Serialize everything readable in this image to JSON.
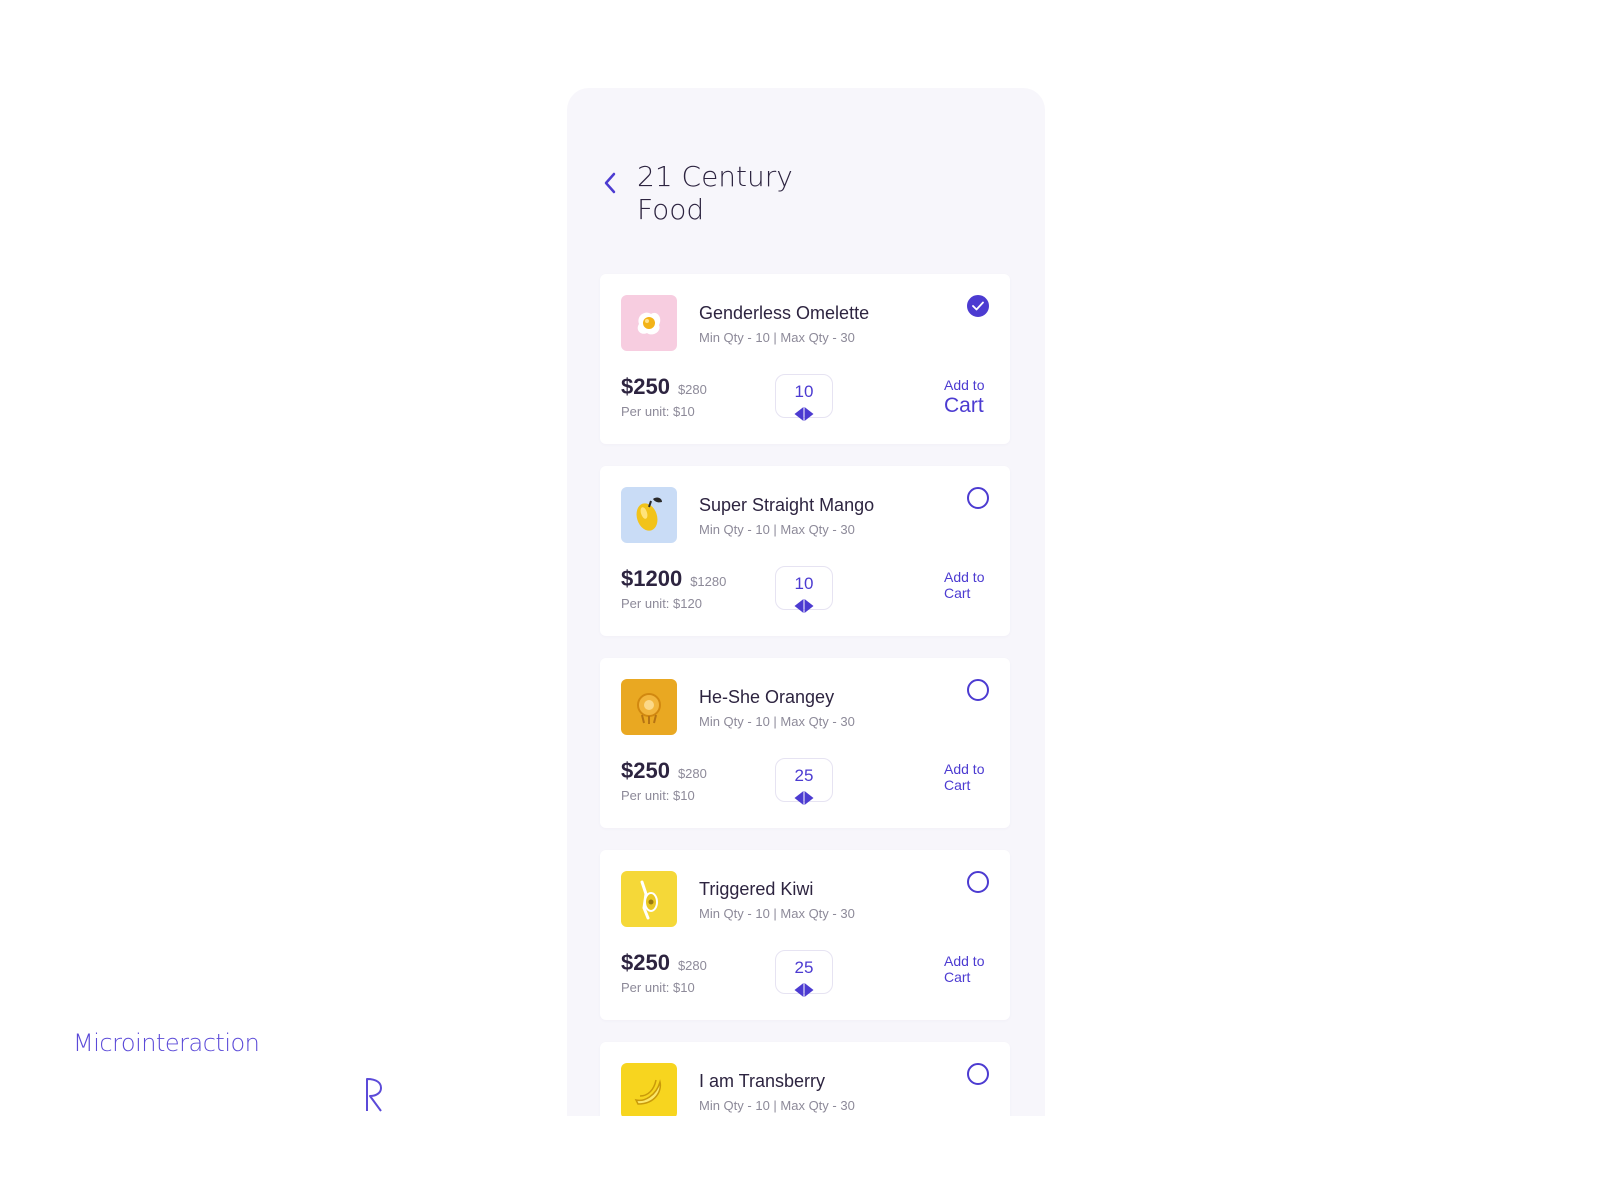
{
  "header": {
    "title": "21 Century Food"
  },
  "products": [
    {
      "name": "Genderless Omelette",
      "qty_range": "Min Qty - 10 | Max Qty - 30",
      "price": "$250",
      "old_price": "$280",
      "per_unit": "Per unit: $10",
      "quantity": "10",
      "selected": true,
      "add_line1": "Add to",
      "add_line2": "Cart",
      "thumb_color": "#f7cde0",
      "icon": "egg-icon"
    },
    {
      "name": "Super Straight Mango",
      "qty_range": "Min Qty - 10 | Max Qty - 30",
      "price": "$1200",
      "old_price": "$1280",
      "per_unit": "Per unit: $120",
      "quantity": "10",
      "selected": false,
      "add_line1": "Add to",
      "add_line2": "Cart",
      "thumb_color": "#c9dcf6",
      "icon": "mango-icon"
    },
    {
      "name": "He-She Orangey",
      "qty_range": "Min Qty - 10 | Max Qty - 30",
      "price": "$250",
      "old_price": "$280",
      "per_unit": "Per unit: $10",
      "quantity": "25",
      "selected": false,
      "add_line1": "Add to",
      "add_line2": "Cart",
      "thumb_color": "#e9a822",
      "icon": "orange-icon"
    },
    {
      "name": "Triggered Kiwi",
      "qty_range": "Min Qty - 10 | Max Qty - 30",
      "price": "$250",
      "old_price": "$280",
      "per_unit": "Per unit: $10",
      "quantity": "25",
      "selected": false,
      "add_line1": "Add to",
      "add_line2": "Cart",
      "thumb_color": "#f5d838",
      "icon": "kiwi-icon"
    },
    {
      "name": "I am Transberry",
      "qty_range": "Min Qty - 10 | Max Qty - 30",
      "selected": false,
      "thumb_color": "#f7d51f",
      "icon": "banana-icon"
    }
  ],
  "footer": {
    "label": "Microinteraction"
  },
  "colors": {
    "accent": "#4c3bd1",
    "text": "#2d2440",
    "muted": "#8d8a99",
    "background": "#f7f6fb"
  }
}
